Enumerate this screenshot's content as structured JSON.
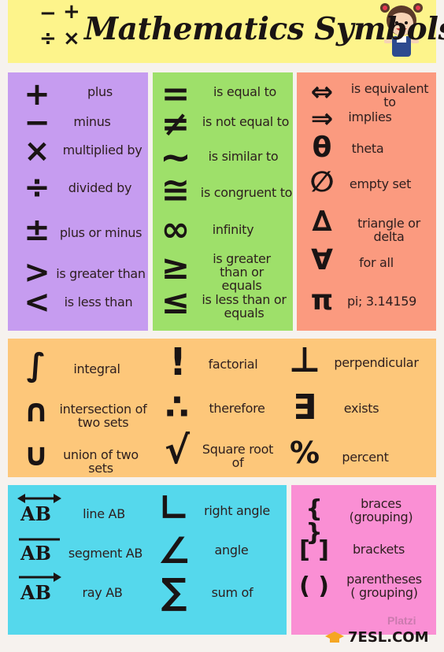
{
  "title": "Mathematics Symbols",
  "header_ops": [
    "−",
    "+",
    "÷",
    "×"
  ],
  "colors": {
    "header": "#fdf48b",
    "purple": "#c69cf0",
    "green": "#9ee06a",
    "salmon": "#fb9a7f",
    "orange": "#fdc77a",
    "cyan": "#55d8ec",
    "pink": "#fa8fd4"
  },
  "purple": [
    {
      "symbol": "+",
      "label": "plus"
    },
    {
      "symbol": "−",
      "label": "minus"
    },
    {
      "symbol": "×",
      "label": "multiplied by"
    },
    {
      "symbol": "÷",
      "label": "divided by"
    },
    {
      "symbol": "±",
      "label": "plus or minus"
    },
    {
      "symbol": ">",
      "label": "is greater than"
    },
    {
      "symbol": "<",
      "label": "is less than"
    }
  ],
  "green": [
    {
      "symbol": "=",
      "label": "is equal to"
    },
    {
      "symbol": "≠",
      "label": "is not equal to"
    },
    {
      "symbol": "~",
      "label": "is similar to"
    },
    {
      "symbol": "≅",
      "label": "is congruent to"
    },
    {
      "symbol": "∞",
      "label": "infinity"
    },
    {
      "symbol": "≥",
      "label": "is greater than or equals"
    },
    {
      "symbol": "≤",
      "label": "is less  than or equals"
    }
  ],
  "salmon": [
    {
      "symbol": "⇔",
      "label": "is equivalent to"
    },
    {
      "symbol": "⇒",
      "label": "implies"
    },
    {
      "symbol": "θ",
      "label": "theta"
    },
    {
      "symbol": "∅",
      "label": "empty set"
    },
    {
      "symbol": "∆",
      "label": "triangle or delta"
    },
    {
      "symbol": "∀",
      "label": "for all"
    },
    {
      "symbol": "π",
      "label": "pi; 3.14159"
    }
  ],
  "orange": [
    {
      "symbol": "∫",
      "label": "integral"
    },
    {
      "symbol": "∩",
      "label": "intersection of two sets"
    },
    {
      "symbol": "∪",
      "label": "union of two sets"
    },
    {
      "symbol": "!",
      "label": "factorial"
    },
    {
      "symbol": "∴",
      "label": "therefore"
    },
    {
      "symbol": "√",
      "label": "Square root of"
    },
    {
      "symbol": "⊥",
      "label": "perpendicular"
    },
    {
      "symbol": "∃",
      "label": "exists"
    },
    {
      "symbol": "%",
      "label": "percent"
    }
  ],
  "cyan": [
    {
      "symbol": "AB",
      "label": "line AB"
    },
    {
      "symbol": "AB",
      "label": "segment AB"
    },
    {
      "symbol": "AB",
      "label": "ray AB"
    },
    {
      "symbol": "∟",
      "label": "right angle"
    },
    {
      "symbol": "∠",
      "label": "angle"
    },
    {
      "symbol": "∑",
      "label": "sum of"
    }
  ],
  "pink": [
    {
      "symbol": "{ }",
      "label": "braces (grouping)"
    },
    {
      "symbol": "[ ]",
      "label": "brackets"
    },
    {
      "symbol": "( )",
      "label": "parentheses ( grouping)"
    }
  ],
  "footer": {
    "brand": "7ESL.COM",
    "watermark": "Platzi"
  }
}
